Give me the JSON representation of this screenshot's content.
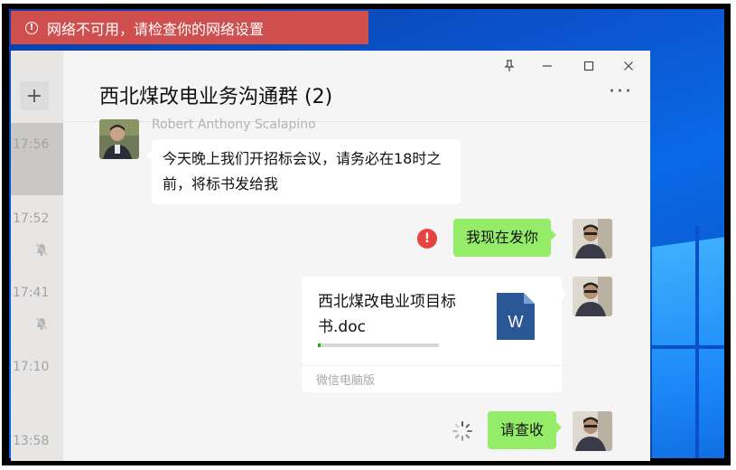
{
  "network_banner": {
    "text": "网络不可用，请检查你的网络设置",
    "icon": "info-circle-icon",
    "color": "#cf4f4f"
  },
  "window_controls": {
    "pin": "𐄹",
    "minimize": "—",
    "maximize": "☐",
    "close": "✕"
  },
  "sidebar": {
    "add_label": "+",
    "times": [
      "17:56",
      "17:52",
      "17:41",
      "17:10",
      "13:58"
    ]
  },
  "chat": {
    "title": "西北煤改电业务沟通群 (2)",
    "more_label": "···",
    "messages": [
      {
        "sender": "Robert Anthony Scalapino",
        "text": "今天晚上我们开招标会议，请务必在18时之前，将标书发给我",
        "direction": "incoming"
      },
      {
        "text": "我现在发你",
        "direction": "outgoing",
        "status": "failed",
        "status_icon_text": "!"
      },
      {
        "direction": "outgoing",
        "type": "file",
        "file_name": "西北煤改电业项目标书.doc",
        "file_icon_text": "W",
        "upload_progress": 0.02,
        "source": "微信电脑版"
      },
      {
        "text": "请查收",
        "direction": "outgoing",
        "status": "sending"
      }
    ]
  },
  "colors": {
    "green_bubble": "#95ec69",
    "error": "#e64340",
    "word_blue": "#2b5797"
  }
}
